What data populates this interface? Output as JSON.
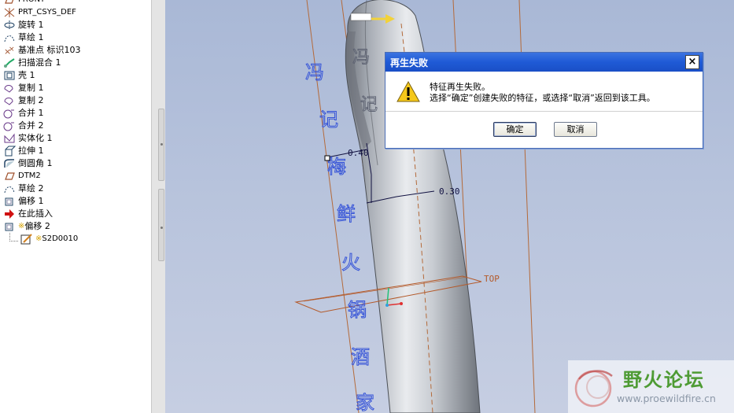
{
  "model_tree": {
    "items": [
      {
        "label": "FRONT",
        "icon": "datum-plane-icon",
        "mono": true
      },
      {
        "label": "PRT_CSYS_DEF",
        "icon": "csys-icon",
        "mono": true
      },
      {
        "label": "旋转 1",
        "icon": "revolve-icon"
      },
      {
        "label": "草绘 1",
        "icon": "sketch-icon"
      },
      {
        "label": "基准点 标识103",
        "icon": "datum-point-icon"
      },
      {
        "label": "扫描混合 1",
        "icon": "swept-blend-icon"
      },
      {
        "label": "壳 1",
        "icon": "shell-icon"
      },
      {
        "label": "复制 1",
        "icon": "copy-icon"
      },
      {
        "label": "复制 2",
        "icon": "copy-icon"
      },
      {
        "label": "合并 1",
        "icon": "merge-icon"
      },
      {
        "label": "合并 2",
        "icon": "merge-icon"
      },
      {
        "label": "实体化 1",
        "icon": "solidify-icon"
      },
      {
        "label": "拉伸 1",
        "icon": "extrude-icon"
      },
      {
        "label": "倒圆角 1",
        "icon": "round-icon"
      },
      {
        "label": "DTM2",
        "icon": "datum-plane-icon",
        "mono": true
      },
      {
        "label": "草绘 2",
        "icon": "sketch-icon"
      },
      {
        "label": "偏移 1",
        "icon": "offset-icon"
      },
      {
        "label": "在此插入",
        "icon": "insert-here-arrow-icon"
      },
      {
        "label": "偏移 2",
        "icon": "offset-icon",
        "prefix": "※"
      },
      {
        "label": "S2D0010",
        "icon": "sketch-edit-icon",
        "prefix": "※",
        "mono": true,
        "indent": true
      }
    ]
  },
  "viewport": {
    "vertical_text": [
      "冯",
      "记",
      "梅",
      "鲜",
      "火",
      "锅",
      "酒",
      "家"
    ],
    "second_text": [
      "冯",
      "记"
    ],
    "dimensions": [
      "0.40",
      "0.30"
    ],
    "datum_label": "TOP",
    "colors": {
      "text": "#3654d8",
      "datum": "#b05a2a",
      "body": "#9aa0aa"
    }
  },
  "dialog": {
    "title": "再生失败",
    "close": "×",
    "message_line1": "特征再生失败。",
    "message_line2": "选择“确定”创建失败的特征，或选择“取消”返回到该工具。",
    "ok": "确定",
    "cancel": "取消",
    "title_color": "#1f5ad6"
  },
  "watermark": {
    "name": "野火论坛",
    "url": "www.proewildfire.cn"
  }
}
